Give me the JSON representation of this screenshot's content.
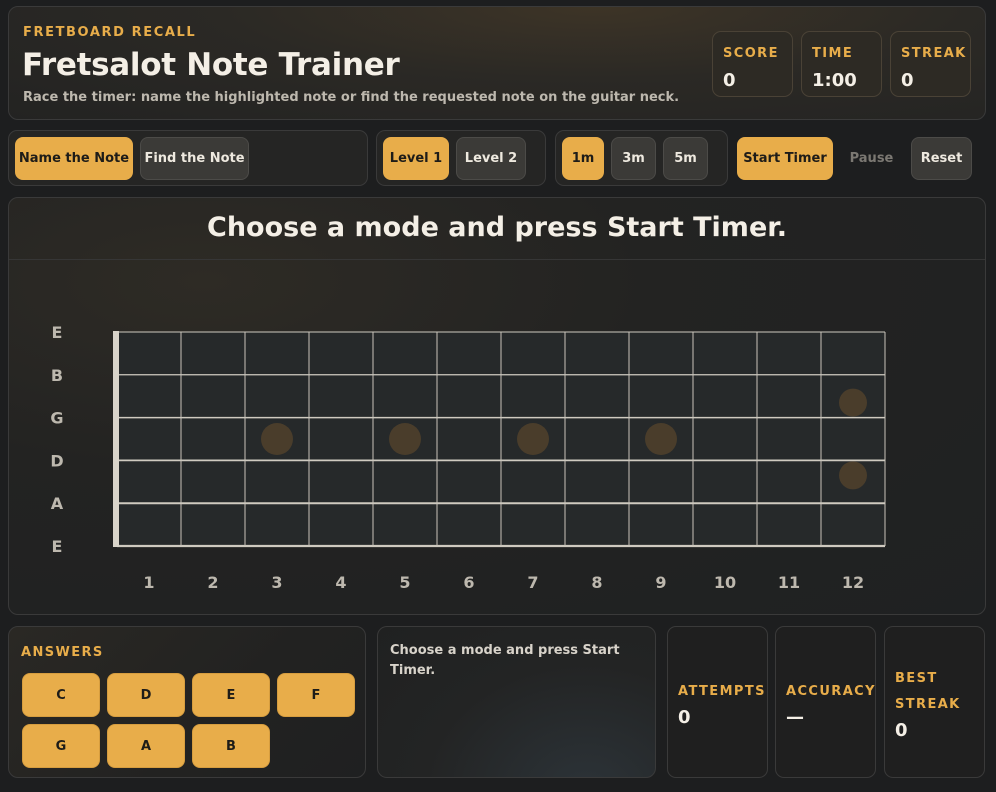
{
  "header": {
    "eyebrow": "FRETBOARD RECALL",
    "title": "Fretsalot Note Trainer",
    "subtitle": "Race the timer: name the highlighted note or find the requested note on the guitar neck.",
    "stats": [
      {
        "label": "SCORE",
        "value": "0"
      },
      {
        "label": "TIME",
        "value": "1:00"
      },
      {
        "label": "STREAK",
        "value": "0"
      }
    ]
  },
  "controls": {
    "modes": [
      {
        "label": "Name the Note",
        "active": true
      },
      {
        "label": "Find the Note",
        "active": false
      }
    ],
    "levels": [
      {
        "label": "Level 1",
        "active": true
      },
      {
        "label": "Level 2",
        "active": false
      }
    ],
    "durations": [
      {
        "label": "1m",
        "active": true
      },
      {
        "label": "3m",
        "active": false
      },
      {
        "label": "5m",
        "active": false
      }
    ],
    "start_label": "Start Timer",
    "pause_label": "Pause",
    "reset_label": "Reset"
  },
  "board": {
    "prompt": "Choose a mode and press Start Timer.",
    "strings": [
      "E",
      "B",
      "G",
      "D",
      "A",
      "E"
    ],
    "frets": [
      "1",
      "2",
      "3",
      "4",
      "5",
      "6",
      "7",
      "8",
      "9",
      "10",
      "11",
      "12"
    ],
    "inlay_frets": [
      3,
      5,
      7,
      9
    ],
    "double_inlay_fret": 12
  },
  "answers": {
    "title": "ANSWERS",
    "notes": [
      "C",
      "D",
      "E",
      "F",
      "G",
      "A",
      "B"
    ]
  },
  "feedback": {
    "text": "Choose a mode and press Start Timer."
  },
  "metrics": [
    {
      "label": "ATTEMPTS",
      "value": "0"
    },
    {
      "label": "ACCURACY",
      "value": "—"
    },
    {
      "label": "BEST STREAK",
      "value": "0"
    }
  ],
  "colors": {
    "accent": "#e8ad4a",
    "background": "#1d1e1f"
  }
}
